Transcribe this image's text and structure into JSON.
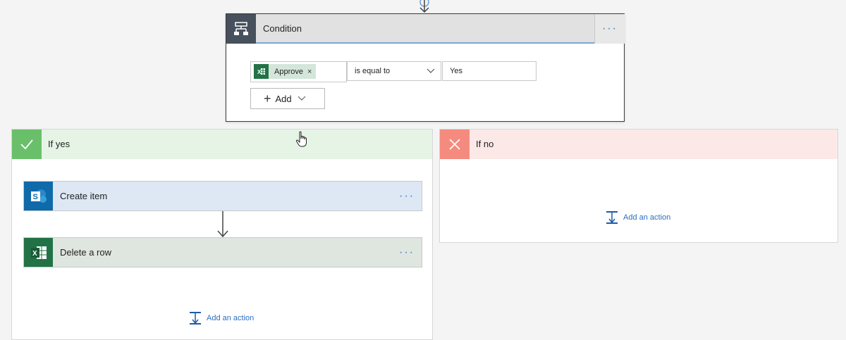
{
  "condition": {
    "title": "Condition",
    "more_label": "···",
    "row": {
      "token_label": "Approve",
      "token_remove": "×",
      "operator": "is equal to",
      "value": "Yes"
    },
    "add_label": "Add"
  },
  "if_yes": {
    "title": "If yes",
    "actions": [
      {
        "title": "Create item",
        "icon": "sharepoint-icon",
        "more_label": "···"
      },
      {
        "title": "Delete a row",
        "icon": "excel-icon",
        "more_label": "···"
      }
    ],
    "add_action_label": "Add an action"
  },
  "if_no": {
    "title": "If no",
    "add_action_label": "Add an action"
  },
  "colors": {
    "condition_header": "#e1e1e1",
    "condition_icon_bg": "#47505d",
    "yes_header": "#e6f4e6",
    "yes_icon_bg": "#6ac06a",
    "no_header": "#fde8e8",
    "no_icon_bg": "#f48b7e",
    "sharepoint": "#0f6aaa",
    "excel": "#217346",
    "link": "#2a6fc1"
  }
}
